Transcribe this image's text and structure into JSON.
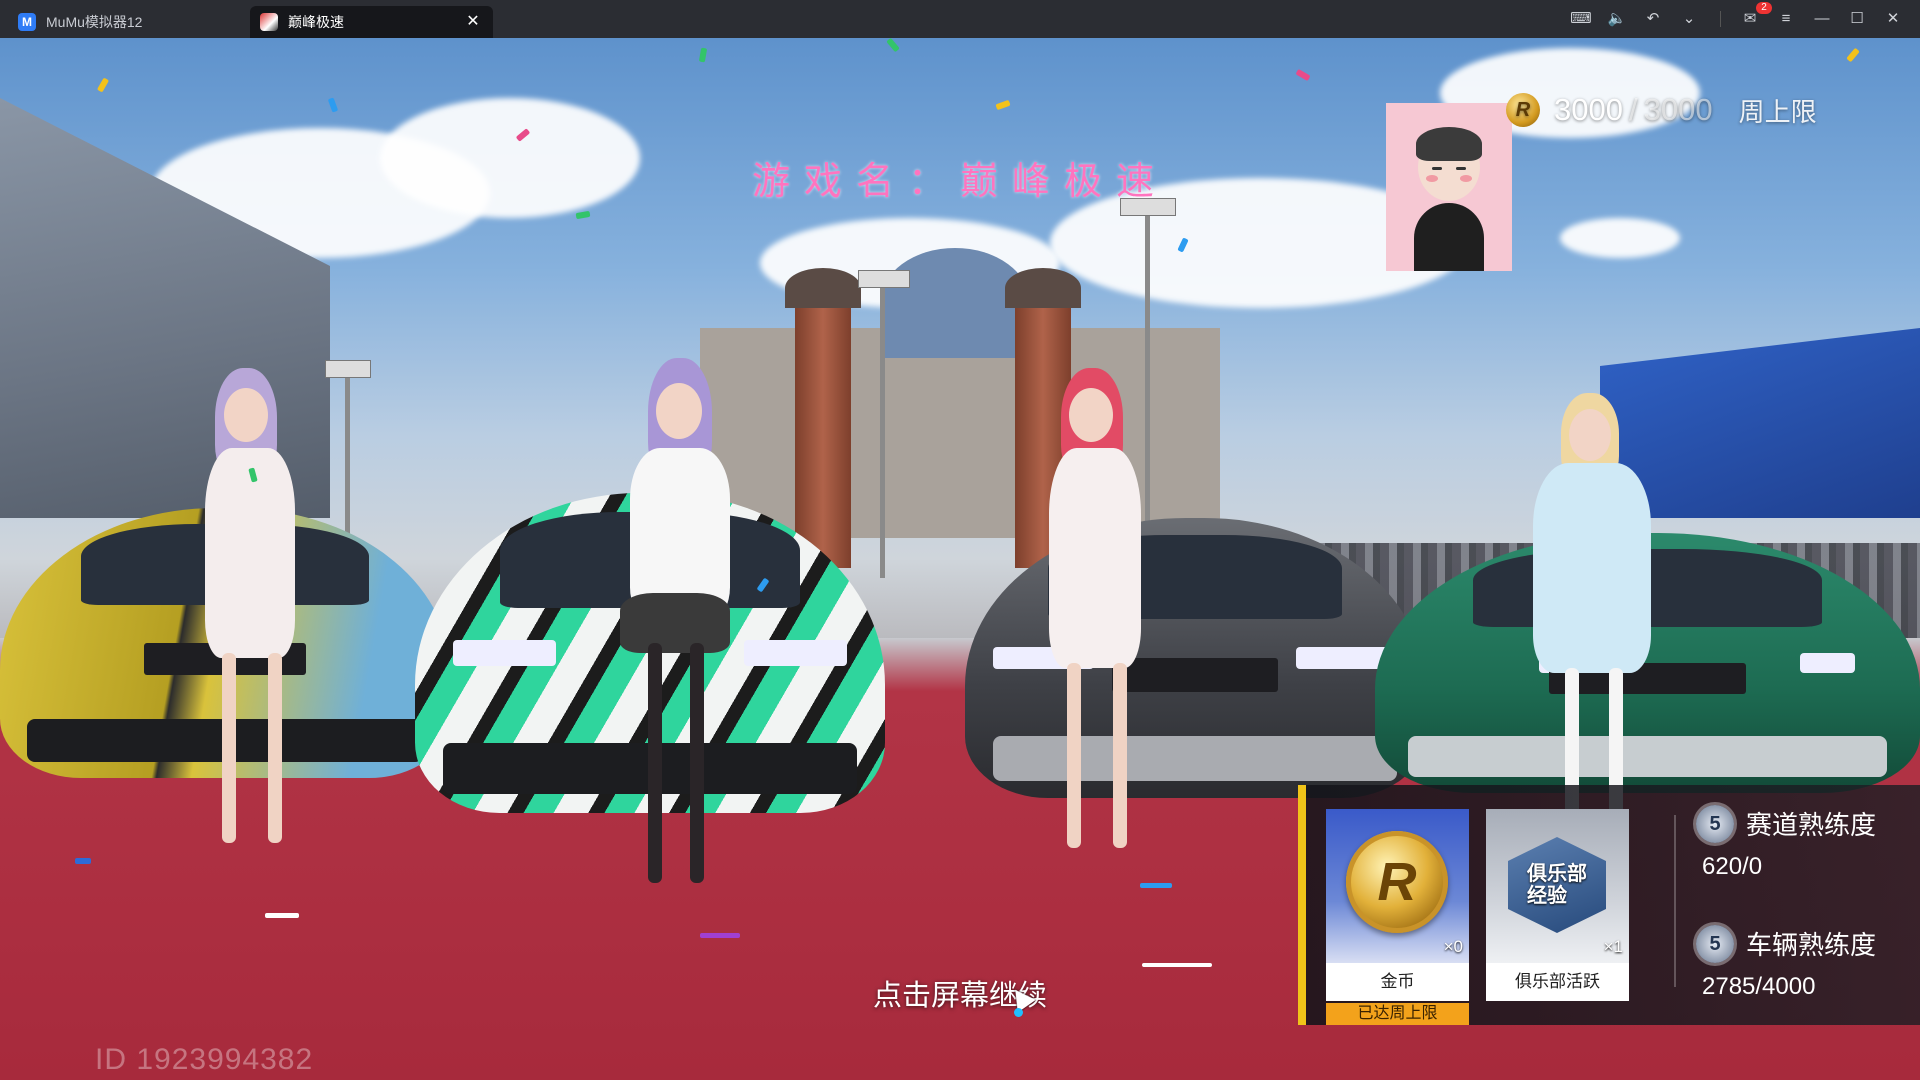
{
  "window": {
    "tabs": [
      {
        "label": "MuMu模拟器12",
        "icon": "mumu-logo-icon",
        "active": false
      },
      {
        "label": "巅峰极速",
        "icon": "game-icon",
        "active": true
      }
    ],
    "controls": [
      "keyboard-icon",
      "volume-icon",
      "undo-icon",
      "chevron-down-icon",
      "mail-icon",
      "menu-icon",
      "minimize-icon",
      "maximize-icon",
      "close-icon"
    ],
    "mail_badge": "2"
  },
  "overlay": {
    "watermark_text": "游戏名：巅峰极速",
    "watermark_color": "#ff74bf"
  },
  "currency": {
    "icon": "r-coin-icon",
    "current": "3000",
    "separator": "/",
    "max": "3000",
    "limit_label": "周上限"
  },
  "rewards": {
    "items": [
      {
        "name": "金币",
        "count": "×0",
        "icon": "gold-coin-icon",
        "icon_text": "R",
        "tag": "已达周上限"
      },
      {
        "name": "俱乐部活跃",
        "count": "×1",
        "icon": "club-activity-badge-icon",
        "icon_text": "俱乐部\n经验"
      }
    ],
    "proficiency": [
      {
        "label": "赛道熟练度",
        "level": "5",
        "value": "620/0",
        "icon": "track-level-icon"
      },
      {
        "label": "车辆熟练度",
        "level": "5",
        "value": "2785/4000",
        "icon": "vehicle-level-icon"
      }
    ],
    "accent_color": "#f0c419"
  },
  "continue_hint": "点击屏幕继续",
  "player_id": "ID 1923994382"
}
